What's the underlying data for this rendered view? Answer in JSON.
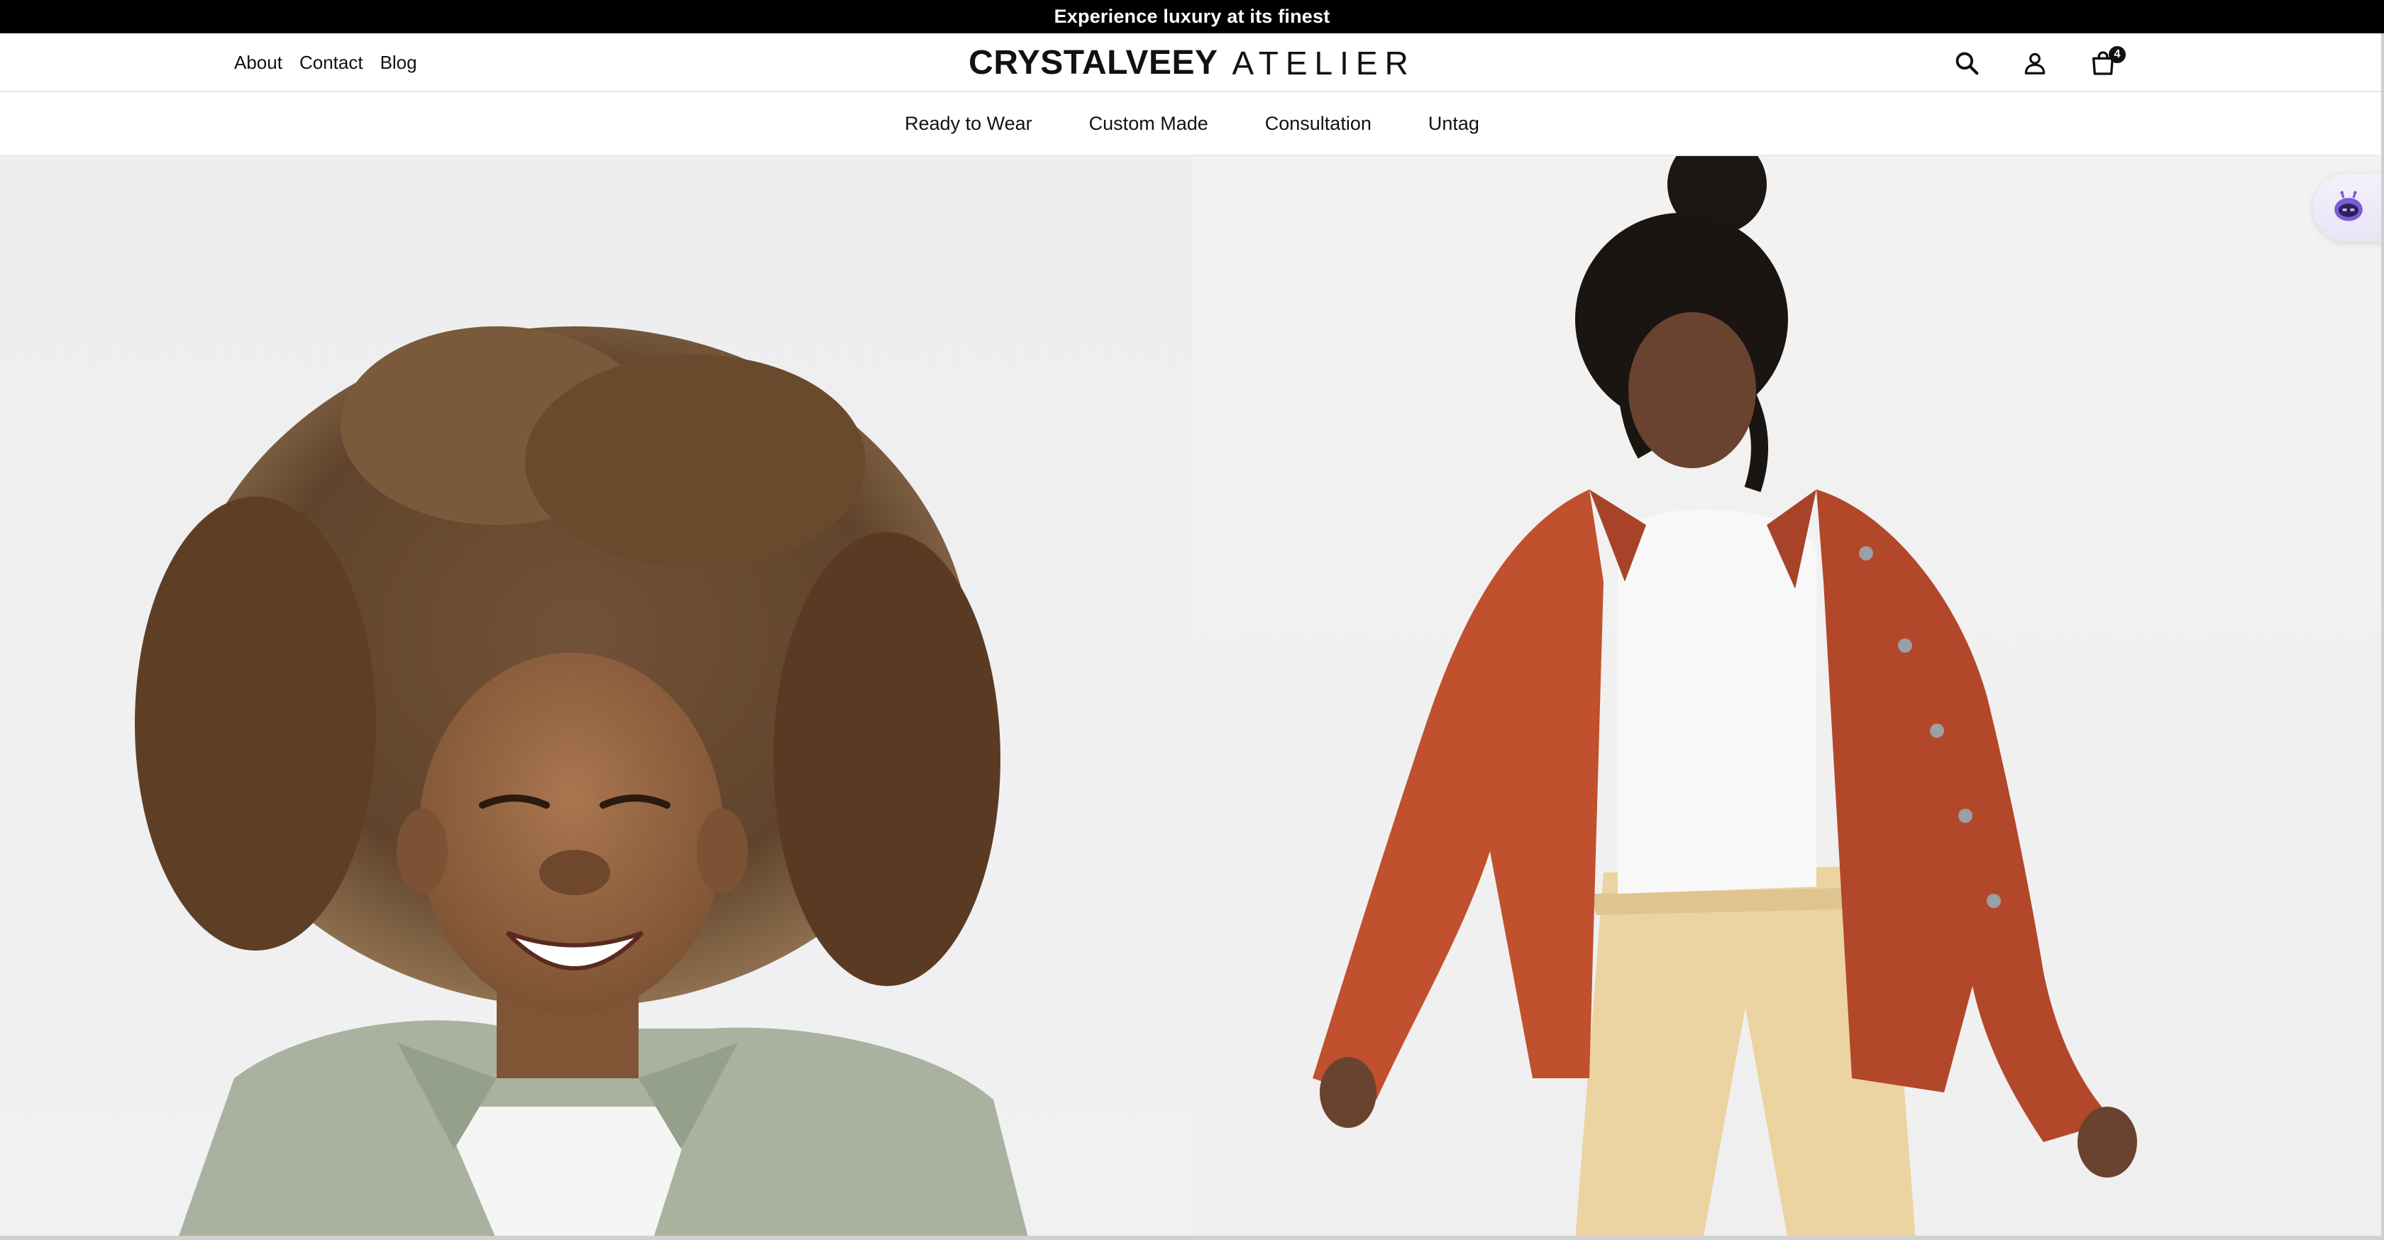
{
  "announcement": {
    "text": "Experience luxury at its finest"
  },
  "header": {
    "util_links": [
      {
        "label": "About"
      },
      {
        "label": "Contact"
      },
      {
        "label": "Blog"
      }
    ],
    "logo": {
      "brand": "CRYSTALVEEY",
      "sub": "ATELIER"
    },
    "icons": {
      "search": "search-icon",
      "account": "user-icon",
      "cart": "shopping-bag-icon"
    },
    "cart_count": "4"
  },
  "main_nav": [
    {
      "label": "Ready to Wear"
    },
    {
      "label": "Custom Made"
    },
    {
      "label": "Consultation"
    },
    {
      "label": "Untag"
    }
  ],
  "hero": {
    "panels": [
      {
        "subject": "smiling child with curly hair wearing sage shirt"
      },
      {
        "subject": "model in rust jacket, white tank top and beige trousers"
      }
    ]
  },
  "colors": {
    "announcement_bg": "#000000",
    "text": "#111111",
    "hero_bg": "#f0f0f1",
    "jacket_rust": "#c0502e",
    "trouser_beige": "#ecd3a2"
  }
}
